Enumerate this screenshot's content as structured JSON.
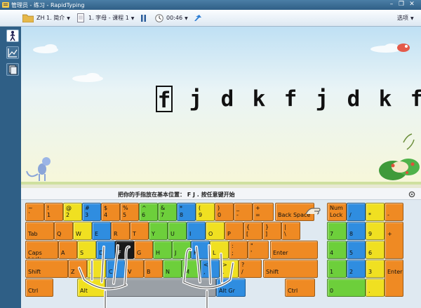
{
  "window": {
    "title": "管理员 - 练习 - RapidTyping",
    "controls": [
      "minimize-icon",
      "restore-icon",
      "close-icon"
    ]
  },
  "toolbar": {
    "course": "ZH 1. 简介",
    "lesson": "1. 字母 - 课程 1",
    "timer": "00:46",
    "options": "选项"
  },
  "sidebar": {
    "items": [
      "walk-icon",
      "chart-icon",
      "pages-icon"
    ]
  },
  "exercise": {
    "letters": [
      "f",
      "j",
      "d",
      "k",
      "f",
      "j",
      "d",
      "k",
      "f"
    ],
    "current_index": 0
  },
  "hint": "把你的手指放在基本位置： F J . 按任意键开始",
  "keyboard": {
    "rows": [
      [
        {
          "u": "~",
          "l": "`",
          "c": "o"
        },
        {
          "u": "!",
          "l": "1",
          "c": "o"
        },
        {
          "u": "@",
          "l": "2",
          "c": "y"
        },
        {
          "u": "#",
          "l": "3",
          "c": "b"
        },
        {
          "u": "$",
          "l": "4",
          "c": "o"
        },
        {
          "u": "%",
          "l": "5",
          "c": "o"
        },
        {
          "u": "^",
          "l": "6",
          "c": "g"
        },
        {
          "u": "&",
          "l": "7",
          "c": "g"
        },
        {
          "u": "*",
          "l": "8",
          "c": "b"
        },
        {
          "u": "(",
          "l": "9",
          "c": "y"
        },
        {
          "u": ")",
          "l": "0",
          "c": "o"
        },
        {
          "u": "_",
          "l": "-",
          "c": "o"
        },
        {
          "u": "+",
          "l": "=",
          "c": "o"
        },
        {
          "u": "",
          "l": "Back Space",
          "c": "o"
        }
      ],
      [
        {
          "u": "",
          "l": "Tab",
          "c": "o"
        },
        {
          "u": "",
          "l": "Q",
          "c": "o"
        },
        {
          "u": "",
          "l": "W",
          "c": "y"
        },
        {
          "u": "",
          "l": "E",
          "c": "b"
        },
        {
          "u": "",
          "l": "R",
          "c": "o"
        },
        {
          "u": "",
          "l": "T",
          "c": "o"
        },
        {
          "u": "",
          "l": "Y",
          "c": "g"
        },
        {
          "u": "",
          "l": "U",
          "c": "g"
        },
        {
          "u": "",
          "l": "I",
          "c": "b"
        },
        {
          "u": "",
          "l": "O",
          "c": "y"
        },
        {
          "u": "",
          "l": "P",
          "c": "o"
        },
        {
          "u": "{",
          "l": "[",
          "c": "o"
        },
        {
          "u": "}",
          "l": "]",
          "c": "o"
        },
        {
          "u": "|",
          "l": "\\",
          "c": "o"
        }
      ],
      [
        {
          "u": "",
          "l": "Caps Lock",
          "c": "o"
        },
        {
          "u": "",
          "l": "A",
          "c": "o"
        },
        {
          "u": "",
          "l": "S",
          "c": "y"
        },
        {
          "u": "",
          "l": "D",
          "c": "b"
        },
        {
          "u": "",
          "l": "F",
          "c": "k"
        },
        {
          "u": "",
          "l": "G",
          "c": "o"
        },
        {
          "u": "",
          "l": "H",
          "c": "g"
        },
        {
          "u": "",
          "l": "J",
          "c": "g"
        },
        {
          "u": "",
          "l": "K",
          "c": "b"
        },
        {
          "u": "",
          "l": "L",
          "c": "y"
        },
        {
          "u": ":",
          "l": ";",
          "c": "o"
        },
        {
          "u": "\"",
          "l": "'",
          "c": "o"
        },
        {
          "u": "",
          "l": "Enter",
          "c": "o"
        }
      ],
      [
        {
          "u": "",
          "l": "Shift",
          "c": "o"
        },
        {
          "u": "",
          "l": "Z",
          "c": "o"
        },
        {
          "u": "",
          "l": "X",
          "c": "y"
        },
        {
          "u": "",
          "l": "C",
          "c": "b"
        },
        {
          "u": "",
          "l": "V",
          "c": "o"
        },
        {
          "u": "",
          "l": "B",
          "c": "o"
        },
        {
          "u": "",
          "l": "N",
          "c": "g"
        },
        {
          "u": "",
          "l": "M",
          "c": "g"
        },
        {
          "u": "<",
          "l": ",",
          "c": "b"
        },
        {
          "u": ">",
          "l": ".",
          "c": "y"
        },
        {
          "u": "?",
          "l": "/",
          "c": "o"
        },
        {
          "u": "",
          "l": "Shift",
          "c": "o"
        }
      ],
      [
        {
          "u": "",
          "l": "Ctrl",
          "c": "o"
        },
        {
          "u": "",
          "l": "Alt",
          "c": "y"
        },
        {
          "u": "",
          "l": "",
          "c": "gy"
        },
        {
          "u": "",
          "l": "Alt Gr",
          "c": "b"
        },
        {
          "u": "",
          "l": "Ctrl",
          "c": "o"
        }
      ]
    ],
    "numpad": [
      {
        "u": "Num",
        "l": "Lock",
        "c": "o"
      },
      {
        "u": "",
        "l": "/",
        "c": "b"
      },
      {
        "u": "",
        "l": "*",
        "c": "y"
      },
      {
        "u": "",
        "l": "-",
        "c": "o"
      },
      {
        "u": "",
        "l": "7",
        "c": "g"
      },
      {
        "u": "",
        "l": "8",
        "c": "b"
      },
      {
        "u": "",
        "l": "9",
        "c": "y"
      },
      {
        "u": "",
        "l": "+",
        "c": "o"
      },
      {
        "u": "",
        "l": "4",
        "c": "g"
      },
      {
        "u": "",
        "l": "5",
        "c": "b"
      },
      {
        "u": "",
        "l": "6",
        "c": "y"
      },
      {
        "u": "",
        "l": "1",
        "c": "g"
      },
      {
        "u": "",
        "l": "2",
        "c": "b"
      },
      {
        "u": "",
        "l": "3",
        "c": "y"
      },
      {
        "u": "",
        "l": "Enter",
        "c": "o"
      },
      {
        "u": "",
        "l": "0",
        "c": "g"
      },
      {
        "u": "",
        "l": ".",
        "c": "y"
      }
    ]
  },
  "colors": {
    "orange": "#ef8a23",
    "yellow": "#f0e021",
    "green": "#6dcf3b",
    "blue": "#2f8de0",
    "active": "#1a1a1a"
  }
}
